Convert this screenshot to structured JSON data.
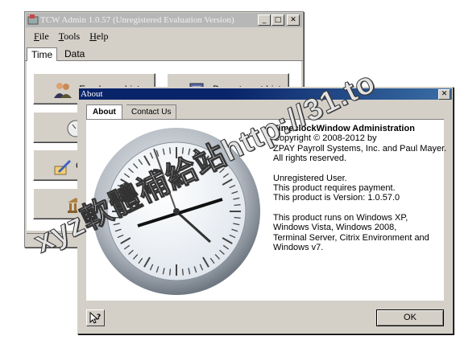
{
  "background_window": {
    "title": "TCW Admin 1.0.57 (Unregistered Evaluation Version)",
    "caption_buttons": {
      "minimize": "_",
      "maximize": "□",
      "close": "✕"
    },
    "menu": [
      {
        "label": "File",
        "accel": "F",
        "rest": "ile"
      },
      {
        "label": "Tools",
        "accel": "T",
        "rest": "ools"
      },
      {
        "label": "Help",
        "accel": "H",
        "rest": "elp"
      }
    ],
    "tabs": [
      "Time",
      "Data"
    ],
    "buttons": [
      {
        "label": "Employee List",
        "icon": "employees-icon"
      },
      {
        "label": "Department List",
        "icon": "department-icon"
      },
      {
        "label": "",
        "icon": "clock-icon"
      },
      {
        "label": "G",
        "icon": "edit-icon"
      },
      {
        "label": "",
        "icon": "bank-icon"
      }
    ]
  },
  "about_dialog": {
    "title": "About",
    "close_symbol": "✕",
    "tabs": [
      "About",
      "Contact Us"
    ],
    "info": {
      "heading": "TimeclockWindow Administration",
      "copyright": "Copyright © 2008-2012 by",
      "company": "ZPAY Payroll Systems, Inc. and Paul Mayer.",
      "rights": "All rights reserved.",
      "user": "Unregistered User.",
      "payment": "This product requires payment.",
      "version": "This product is Version: 1.0.57.0",
      "runs_on_1": "This product runs on Windows XP,",
      "runs_on_2": "Windows Vista, Windows 2008,",
      "runs_on_3": "Terminal Server, Citrix Environment and",
      "runs_on_4": "Windows v7."
    },
    "ok_label": "OK",
    "help_icon": "help-pointer-icon"
  },
  "watermark": "xyz軟體補給站http://31.to"
}
